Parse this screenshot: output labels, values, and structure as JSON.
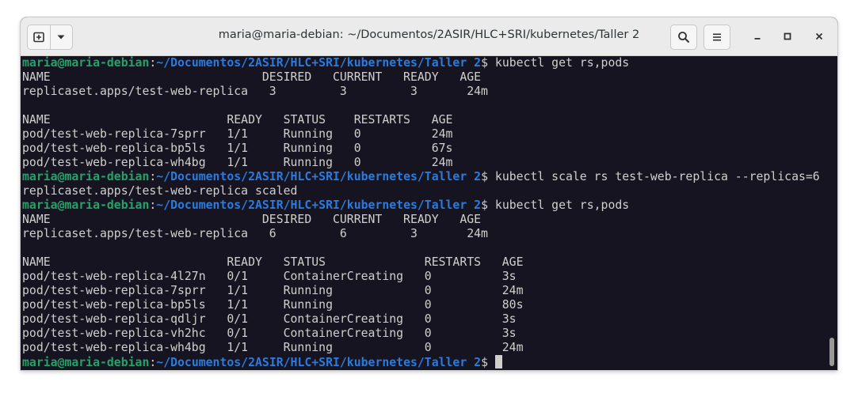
{
  "window": {
    "title": "maria@maria-debian: ~/Documentos/2ASIR/HLC+SRI/kubernetes/Taller 2"
  },
  "titlebar": {
    "new_tab_icon": "new-tab-icon",
    "menu_chevron_icon": "chevron-down-icon",
    "search_icon": "search-icon",
    "hamburger_icon": "hamburger-menu-icon",
    "minimize_icon": "minimize-icon",
    "maximize_icon": "maximize-icon",
    "close_icon": "close-icon"
  },
  "terminal": {
    "prompt_user": "maria@maria-debian",
    "prompt_sep": ":",
    "prompt_path": "~/Documentos/2ASIR/HLC+SRI/kubernetes/Taller 2",
    "prompt_end": "$",
    "lines": [
      {
        "type": "prompt",
        "cmd": " kubectl get rs,pods"
      },
      {
        "type": "out",
        "text": "NAME                              DESIRED   CURRENT   READY   AGE"
      },
      {
        "type": "out",
        "text": "replicaset.apps/test-web-replica   3         3         3       24m"
      },
      {
        "type": "out",
        "text": ""
      },
      {
        "type": "out",
        "text": "NAME                         READY   STATUS    RESTARTS   AGE"
      },
      {
        "type": "out",
        "text": "pod/test-web-replica-7sprr   1/1     Running   0          24m"
      },
      {
        "type": "out",
        "text": "pod/test-web-replica-bp5ls   1/1     Running   0          67s"
      },
      {
        "type": "out",
        "text": "pod/test-web-replica-wh4bg   1/1     Running   0          24m"
      },
      {
        "type": "prompt",
        "cmd": " kubectl scale rs test-web-replica --replicas=6"
      },
      {
        "type": "out",
        "text": "replicaset.apps/test-web-replica scaled"
      },
      {
        "type": "prompt",
        "cmd": " kubectl get rs,pods"
      },
      {
        "type": "out",
        "text": "NAME                              DESIRED   CURRENT   READY   AGE"
      },
      {
        "type": "out",
        "text": "replicaset.apps/test-web-replica   6         6         3       24m"
      },
      {
        "type": "out",
        "text": ""
      },
      {
        "type": "out",
        "text": "NAME                         READY   STATUS              RESTARTS   AGE"
      },
      {
        "type": "out",
        "text": "pod/test-web-replica-4l27n   0/1     ContainerCreating   0          3s"
      },
      {
        "type": "out",
        "text": "pod/test-web-replica-7sprr   1/1     Running             0          24m"
      },
      {
        "type": "out",
        "text": "pod/test-web-replica-bp5ls   1/1     Running             0          80s"
      },
      {
        "type": "out",
        "text": "pod/test-web-replica-qdljr   0/1     ContainerCreating   0          3s"
      },
      {
        "type": "out",
        "text": "pod/test-web-replica-vh2hc   0/1     ContainerCreating   0          3s"
      },
      {
        "type": "out",
        "text": "pod/test-web-replica-wh4bg   1/1     Running             0          24m"
      },
      {
        "type": "prompt",
        "cmd": " ",
        "cursor": true
      }
    ]
  },
  "colors": {
    "background": "#171421",
    "foreground": "#d0cfcc",
    "prompt_user": "#26a269",
    "prompt_path": "#2a7bde"
  }
}
